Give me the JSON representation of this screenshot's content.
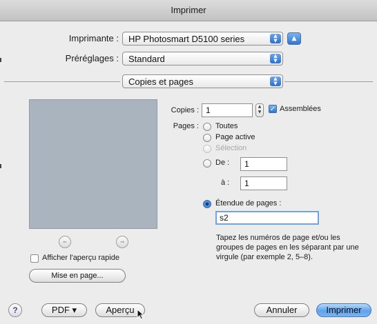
{
  "window": {
    "title": "Imprimer"
  },
  "printer": {
    "label": "Imprimante :",
    "value": "HP Photosmart D5100 series"
  },
  "presets": {
    "label": "Préréglages :",
    "value": "Standard"
  },
  "section": {
    "value": "Copies et pages"
  },
  "copies": {
    "label": "Copies :",
    "value": "1",
    "collate_label": "Assemblées",
    "collate_checked": true
  },
  "pages": {
    "label": "Pages :",
    "options": {
      "all": "Toutes",
      "current": "Page active",
      "selection": "Sélection",
      "from": "De :",
      "to": "à :",
      "range": "Étendue de pages :"
    },
    "from_value": "1",
    "to_value": "1",
    "range_value": "s2",
    "selected": "range"
  },
  "info": {
    "text": "Tapez les numéros de page et/ou les groupes de pages en les séparant par une virgule (par exemple 2, 5–8)."
  },
  "preview": {
    "show_quick_preview_label": "Afficher l'aperçu rapide",
    "quick_preview_checked": false
  },
  "buttons": {
    "page_setup": "Mise en page...",
    "help": "?",
    "pdf": "PDF ▾",
    "preview": "Aperçu",
    "cancel": "Annuler",
    "print": "Imprimer"
  },
  "colors": {
    "accent": "#2f75d6",
    "preview_bg": "#a9b4bf",
    "window_bg": "#ececec"
  }
}
